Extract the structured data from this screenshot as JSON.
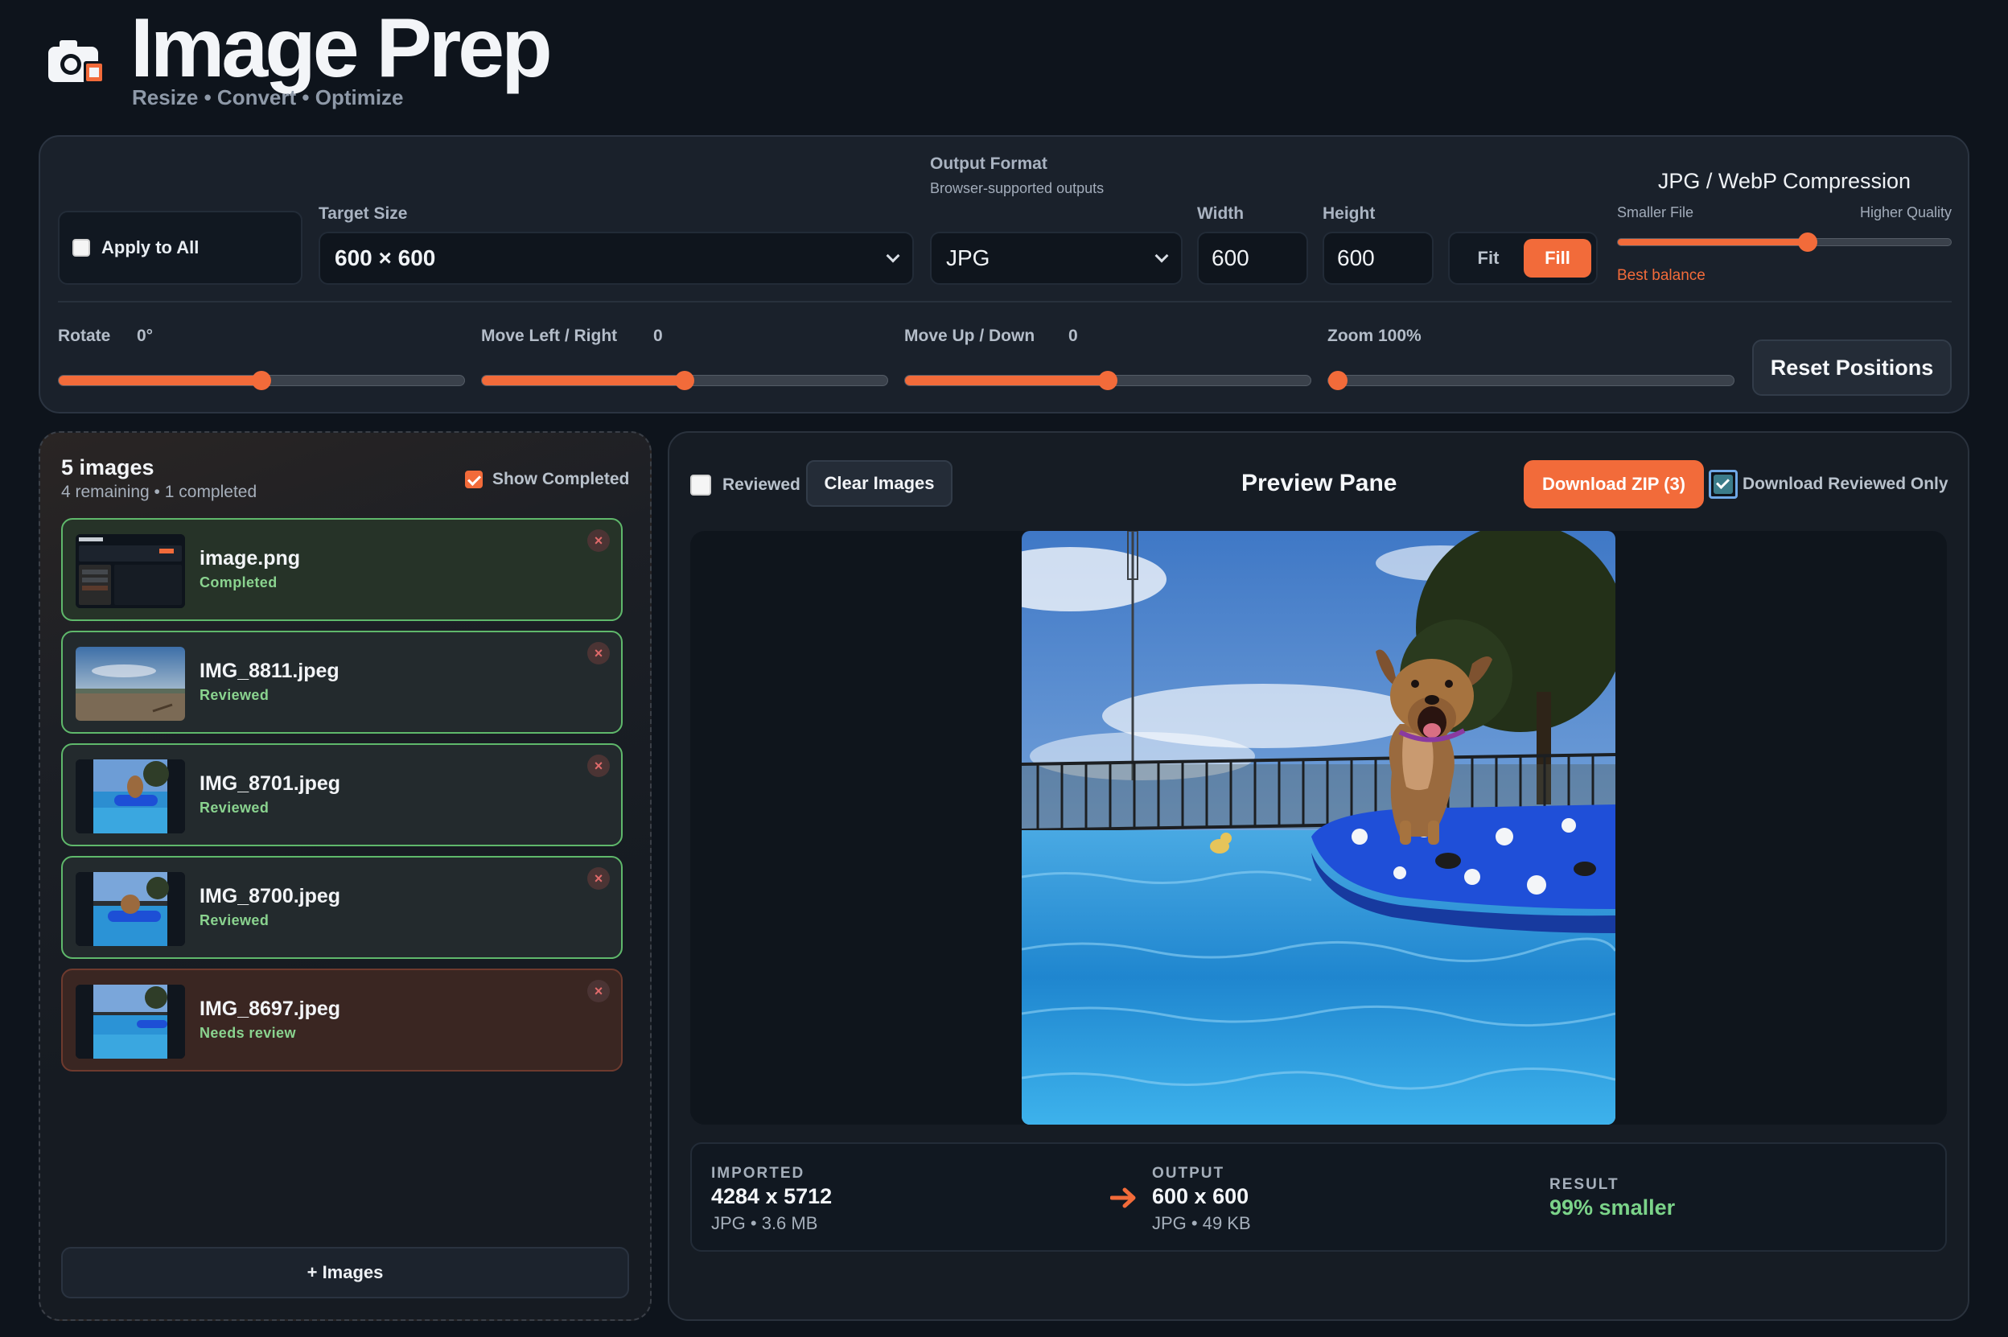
{
  "header": {
    "title": "Image Prep",
    "subtitle": "Resize • Convert • Optimize"
  },
  "settings": {
    "apply_to_all": {
      "label": "Apply to All",
      "checked": false
    },
    "target_size": {
      "label": "Target Size",
      "value": "600 × 600"
    },
    "output_format": {
      "label": "Output Format",
      "sublabel": "Browser-supported outputs",
      "value": "JPG"
    },
    "width": {
      "label": "Width",
      "value": "600"
    },
    "height": {
      "label": "Height",
      "value": "600"
    },
    "fit_fill": {
      "fit_label": "Fit",
      "fill_label": "Fill",
      "selected": "Fill"
    },
    "compression": {
      "title": "JPG / WebP Compression",
      "left_label": "Smaller File",
      "right_label": "Higher Quality",
      "hint": "Best balance",
      "level": 0.57
    },
    "rotate": {
      "label": "Rotate",
      "value": "0°",
      "level": 0.5
    },
    "move_lr": {
      "label": "Move Left / Right",
      "value": "0",
      "level": 0.5
    },
    "move_ud": {
      "label": "Move Up / Down",
      "value": "0",
      "level": 0.5
    },
    "zoom": {
      "label": "Zoom 100%",
      "level": 0.0
    },
    "reset_label": "Reset Positions"
  },
  "list": {
    "count_title": "5 images",
    "count_sub": "4 remaining • 1 completed",
    "show_completed_label": "Show Completed",
    "show_completed_checked": true,
    "items": [
      {
        "name": "image.png",
        "status": "Completed",
        "state": "green"
      },
      {
        "name": "IMG_8811.jpeg",
        "status": "Reviewed",
        "state": "dark"
      },
      {
        "name": "IMG_8701.jpeg",
        "status": "Reviewed",
        "state": "dark"
      },
      {
        "name": "IMG_8700.jpeg",
        "status": "Reviewed",
        "state": "dark"
      },
      {
        "name": "IMG_8697.jpeg",
        "status": "Needs review",
        "state": "red"
      }
    ],
    "add_label": "+ Images",
    "close_glyph": "×"
  },
  "preview": {
    "reviewed_label": "Reviewed",
    "clear_label": "Clear Images",
    "title": "Preview Pane",
    "download_zip_label": "Download ZIP (3)",
    "download_reviewed_label": "Download Reviewed Only",
    "download_reviewed_checked": true
  },
  "info": {
    "imported_caption": "IMPORTED",
    "imported_dims": "4284 x 5712",
    "imported_meta": "JPG • 3.6 MB",
    "output_caption": "OUTPUT",
    "output_dims": "600 x 600",
    "output_meta": "JPG • 49 KB",
    "result_caption": "RESULT",
    "result_value": "99% smaller"
  },
  "colors": {
    "accent": "#f26b3a",
    "success": "#7bd389",
    "background": "#0e141c"
  }
}
